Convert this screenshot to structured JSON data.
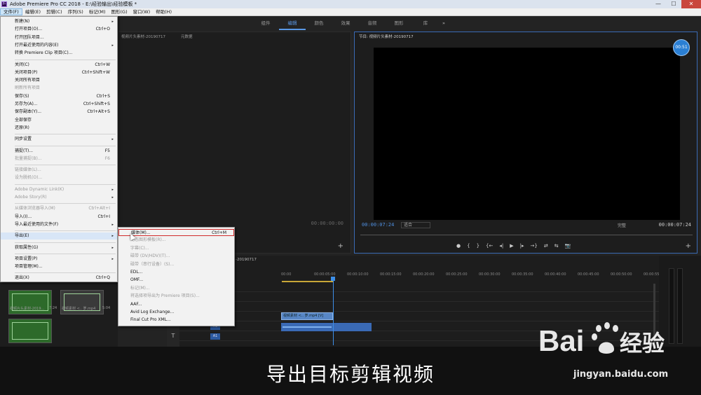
{
  "window": {
    "title": "Adobe Premiere Pro CC 2018 - E:\\经验输出\\经验模板 *",
    "app_icon_text": "Pr",
    "controls": [
      "—",
      "☐",
      "✕"
    ]
  },
  "menubar": {
    "items": [
      "文件(F)",
      "编辑(E)",
      "剪辑(C)",
      "序列(S)",
      "标记(M)",
      "图形(G)",
      "窗口(W)",
      "帮助(H)"
    ],
    "active_index": 0
  },
  "workspace": {
    "tabs": [
      "组件",
      "编辑",
      "颜色",
      "效果",
      "音频",
      "图形",
      "库"
    ],
    "active_index": 1,
    "more": "»"
  },
  "source_panel": {
    "tabs": [
      "视频片头素材-20190717",
      "元数据"
    ],
    "timecode": "00:00:00:00",
    "add": "+"
  },
  "program_panel": {
    "tab": "节目: 视频片头素材-20190717",
    "badge": "00:51",
    "timecode_left": "00:00:07:24",
    "fit": "适合",
    "quality": "完整",
    "timecode_right": "00:00:07:24",
    "transport": [
      "●",
      "{",
      "}",
      "{←",
      "◂|",
      "▶",
      "|▸",
      "→}",
      "⇄",
      "⇆",
      "📷"
    ],
    "add": "+"
  },
  "project_panel": {
    "items": [
      {
        "label": "视频片头素材-2019...",
        "duration": "7:24"
      },
      {
        "label": "视频素材 <.. 罗.mp4",
        "duration": "5:04"
      },
      {
        "label": "",
        "duration": ""
      }
    ]
  },
  "tools": [
    "T"
  ],
  "timeline": {
    "tab": "-20190717",
    "ruler": [
      "00:00",
      "00:00:05:00",
      "00:00:10:00",
      "00:00:15:00",
      "00:00:20:00",
      "00:00:25:00",
      "00:00:30:00",
      "00:00:35:00",
      "00:00:40:00",
      "00:00:45:00",
      "00:00:50:00",
      "00:00:55:0"
    ],
    "tracks": [
      "V1",
      "A1",
      "A1"
    ],
    "clip_v1": "视频素材 <.. 罗.mp4 [V]"
  },
  "file_menu": {
    "items": [
      {
        "label": "新建(N)",
        "shortcut": "",
        "submenu": true,
        "disabled": false
      },
      {
        "label": "打开项目(O)...",
        "shortcut": "Ctrl+O",
        "submenu": false,
        "disabled": false
      },
      {
        "label": "打开团队项目...",
        "shortcut": "",
        "submenu": false,
        "disabled": false
      },
      {
        "label": "打开最近使用的内容(E)",
        "shortcut": "",
        "submenu": true,
        "disabled": false
      },
      {
        "label": "转换 Premiere Clip 项目(C)...",
        "shortcut": "",
        "submenu": false,
        "disabled": false
      },
      {
        "sep": true
      },
      {
        "label": "关闭(C)",
        "shortcut": "Ctrl+W",
        "submenu": false,
        "disabled": false
      },
      {
        "label": "关闭项目(P)",
        "shortcut": "Ctrl+Shift+W",
        "submenu": false,
        "disabled": false
      },
      {
        "label": "关闭所有项目",
        "shortcut": "",
        "submenu": false,
        "disabled": false
      },
      {
        "label": "刷新所有项目",
        "shortcut": "",
        "submenu": false,
        "disabled": true
      },
      {
        "label": "保存(S)",
        "shortcut": "Ctrl+S",
        "submenu": false,
        "disabled": false
      },
      {
        "label": "另存为(A)...",
        "shortcut": "Ctrl+Shift+S",
        "submenu": false,
        "disabled": false
      },
      {
        "label": "保存副本(Y)...",
        "shortcut": "Ctrl+Alt+S",
        "submenu": false,
        "disabled": false
      },
      {
        "label": "全部保存",
        "shortcut": "",
        "submenu": false,
        "disabled": false
      },
      {
        "label": "还原(R)",
        "shortcut": "",
        "submenu": false,
        "disabled": false
      },
      {
        "sep": true
      },
      {
        "label": "同步设置",
        "shortcut": "",
        "submenu": true,
        "disabled": false
      },
      {
        "sep": true
      },
      {
        "label": "捕捉(T)...",
        "shortcut": "F5",
        "submenu": false,
        "disabled": false
      },
      {
        "label": "批量捕捉(B)...",
        "shortcut": "F6",
        "submenu": false,
        "disabled": true
      },
      {
        "sep": true
      },
      {
        "label": "链接媒体(L)...",
        "shortcut": "",
        "submenu": false,
        "disabled": true
      },
      {
        "label": "设为脱机(O)...",
        "shortcut": "",
        "submenu": false,
        "disabled": true
      },
      {
        "sep": true
      },
      {
        "label": "Adobe Dynamic Link(K)",
        "shortcut": "",
        "submenu": true,
        "disabled": true
      },
      {
        "label": "Adobe Story(R)",
        "shortcut": "",
        "submenu": true,
        "disabled": true
      },
      {
        "sep": true
      },
      {
        "label": "从媒体浏览器导入(M)",
        "shortcut": "Ctrl+Alt+I",
        "submenu": false,
        "disabled": true
      },
      {
        "label": "导入(I)...",
        "shortcut": "Ctrl+I",
        "submenu": false,
        "disabled": false
      },
      {
        "label": "导入最近使用的文件(F)",
        "shortcut": "",
        "submenu": true,
        "disabled": false
      },
      {
        "sep": true
      },
      {
        "label": "导出(E)",
        "shortcut": "",
        "submenu": true,
        "disabled": false,
        "highlight": true
      },
      {
        "sep": true
      },
      {
        "label": "获取属性(G)",
        "shortcut": "",
        "submenu": true,
        "disabled": false
      },
      {
        "sep": true
      },
      {
        "label": "项目设置(P)",
        "shortcut": "",
        "submenu": true,
        "disabled": false
      },
      {
        "label": "项目管理(M)...",
        "shortcut": "",
        "submenu": false,
        "disabled": false
      },
      {
        "sep": true
      },
      {
        "label": "退出(X)",
        "shortcut": "Ctrl+Q",
        "submenu": false,
        "disabled": false
      }
    ]
  },
  "export_submenu": {
    "items": [
      {
        "label": "媒体(M)...",
        "shortcut": "Ctrl+M",
        "disabled": false,
        "boxed": true
      },
      {
        "label": "动态图形模板(R)...",
        "shortcut": "",
        "disabled": true
      },
      {
        "label": "字幕(C)...",
        "shortcut": "",
        "disabled": true
      },
      {
        "label": "磁带 (DV/HDV)(T)...",
        "shortcut": "",
        "disabled": true
      },
      {
        "label": "磁带（串行设备）(S)...",
        "shortcut": "",
        "disabled": true
      },
      {
        "label": "EDL...",
        "shortcut": "",
        "disabled": false
      },
      {
        "label": "OMF...",
        "shortcut": "",
        "disabled": false
      },
      {
        "label": "标记(M)...",
        "shortcut": "",
        "disabled": true
      },
      {
        "label": "将选择项导出为 Premiere 项目(S)...",
        "shortcut": "",
        "disabled": true
      },
      {
        "label": "AAF...",
        "shortcut": "",
        "disabled": false
      },
      {
        "label": "Avid Log Exchange...",
        "shortcut": "",
        "disabled": false
      },
      {
        "label": "Final Cut Pro XML...",
        "shortcut": "",
        "disabled": false
      }
    ]
  },
  "caption": "导出目标剪辑视频",
  "watermark": {
    "brand": "Bai 经验",
    "url": "jingyan.baidu.com"
  },
  "colors": {
    "accent": "#2a7fd4",
    "timecode": "#4f8fe0",
    "highlight_box": "#d12b2b",
    "clip": "#5887c6"
  }
}
